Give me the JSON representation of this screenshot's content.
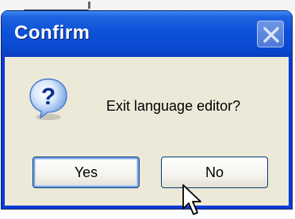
{
  "dialog": {
    "title": "Confirm",
    "message": "Exit language editor?",
    "icon": "question-icon",
    "buttons": [
      {
        "label": "Yes",
        "default": true
      },
      {
        "label": "No",
        "default": false
      }
    ],
    "close_icon": "close-icon"
  },
  "colors": {
    "titlebar": "#0a49d0",
    "frame": "#0b3ad6",
    "client_bg": "#ece9d8",
    "button_border": "#003c74"
  }
}
